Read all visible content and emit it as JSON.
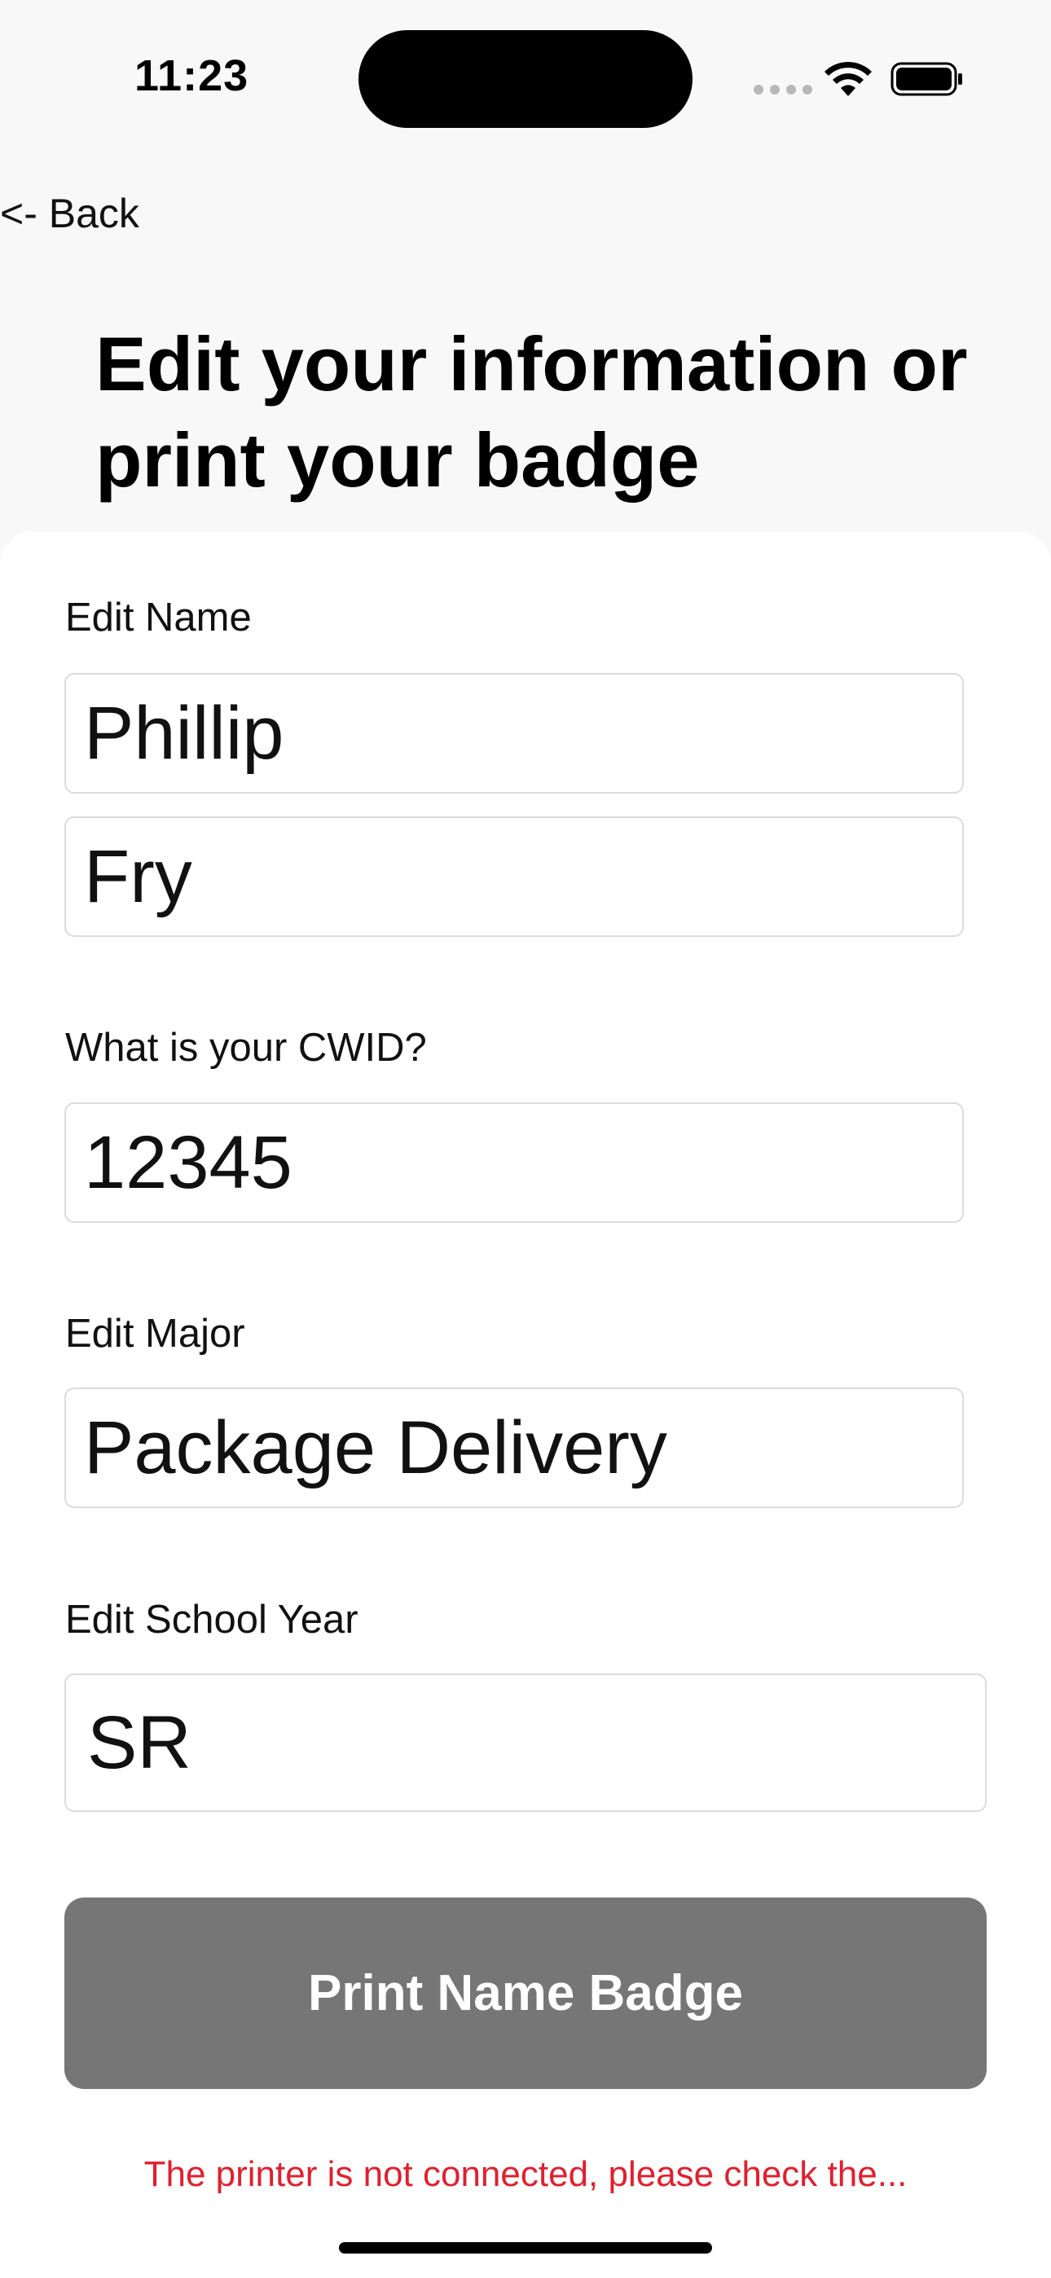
{
  "status_bar": {
    "time": "11:23"
  },
  "nav": {
    "back_label": "<- Back"
  },
  "header": {
    "title": "Edit your information or print your badge"
  },
  "form": {
    "name_label": "Edit Name",
    "first_name": "Phillip",
    "last_name": "Fry",
    "cwid_label": "What is your CWID?",
    "cwid": "12345",
    "major_label": "Edit Major",
    "major": "Package Delivery",
    "year_label": "Edit School Year",
    "year": "SR"
  },
  "actions": {
    "print_label": "Print Name Badge"
  },
  "status": {
    "error_message": "The printer is not connected, please check the..."
  },
  "colors": {
    "button_bg": "#767676",
    "error": "#e0202e",
    "background": "#f8f8f8",
    "card": "#ffffff"
  },
  "icons": [
    "signal-icon",
    "wifi-icon",
    "battery-icon"
  ]
}
